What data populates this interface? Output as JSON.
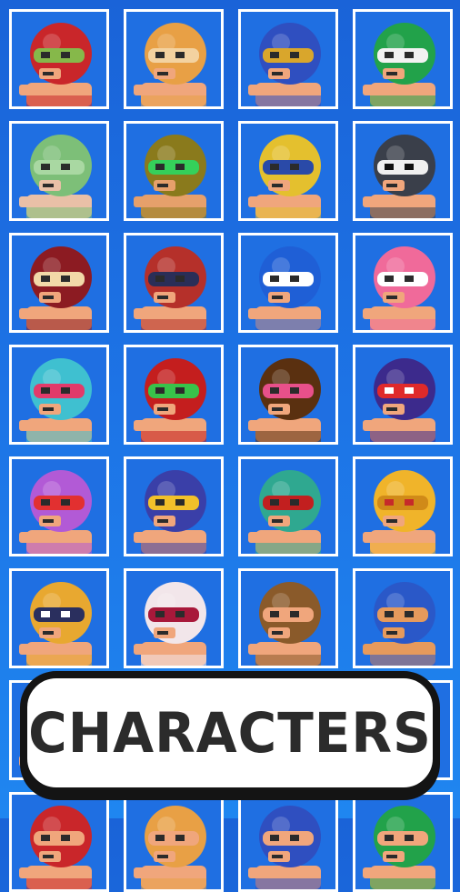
{
  "banner": {
    "label": "CHARACTERS"
  },
  "characters": [
    {
      "name": "red-mask-wrestler-icon",
      "helmet": "#c9262a",
      "mask": "#86b84a",
      "skin": "#f0a67c",
      "accent": "#2b2b2b"
    },
    {
      "name": "star-head-wrestler-icon",
      "helmet": "#e8a045",
      "mask": "#f3d2a0",
      "skin": "#f0a67c",
      "accent": "#2b2b2b"
    },
    {
      "name": "blue-gold-mask-wrestler-icon",
      "helmet": "#2f4fc0",
      "mask": "#d9a62c",
      "skin": "#f0a67c",
      "accent": "#2b2b2b"
    },
    {
      "name": "green-mask-wrestler-icon",
      "helmet": "#22a24a",
      "mask": "#f2f2f2",
      "skin": "#f0a67c",
      "accent": "#2b2b2b"
    },
    {
      "name": "light-green-mask-wrestler-icon",
      "helmet": "#7dbf78",
      "mask": "#a9d8a2",
      "skin": "#e9c0a7",
      "accent": "#2b2b2b"
    },
    {
      "name": "olive-mask-wrestler-icon",
      "helmet": "#8a7a1c",
      "mask": "#35d05a",
      "skin": "#e6a06b",
      "accent": "#2b2b2b"
    },
    {
      "name": "yellow-mask-wrestler-icon",
      "helmet": "#e4c02e",
      "mask": "#2a4aa8",
      "skin": "#f0a67c",
      "accent": "#2b2b2b"
    },
    {
      "name": "skull-mask-wrestler-icon",
      "helmet": "#3a3f4a",
      "mask": "#f0f0f0",
      "skin": "#f0a67c",
      "accent": "#111111"
    },
    {
      "name": "crimson-moon-mask-wrestler-icon",
      "helmet": "#8c1b22",
      "mask": "#f2d9a8",
      "skin": "#f0a67c",
      "accent": "#2b2b2b"
    },
    {
      "name": "dark-red-navy-mask-wrestler-icon",
      "helmet": "#b5302a",
      "mask": "#2a2e57",
      "skin": "#f0a67c",
      "accent": "#2b2b2b"
    },
    {
      "name": "blue-white-mask-wrestler-icon",
      "helmet": "#1f5fd6",
      "mask": "#ffffff",
      "skin": "#f0a67c",
      "accent": "#2b2b2b"
    },
    {
      "name": "pink-mask-wrestler-icon",
      "helmet": "#f06a9a",
      "mask": "#ffffff",
      "skin": "#f0a67c",
      "accent": "#2b2b2b"
    },
    {
      "name": "teal-mask-wrestler-icon",
      "helmet": "#3fc0d0",
      "mask": "#e23a6a",
      "skin": "#f0a67c",
      "accent": "#2b2b2b"
    },
    {
      "name": "red-green-mask-wrestler-icon",
      "helmet": "#c41e1e",
      "mask": "#38c24a",
      "skin": "#f0a67c",
      "accent": "#2b2b2b"
    },
    {
      "name": "brown-mask-wrestler-icon",
      "helmet": "#5a3010",
      "mask": "#e8508a",
      "skin": "#f0a67c",
      "accent": "#2b2b2b"
    },
    {
      "name": "stripe-mask-wrestler-icon",
      "helmet": "#3c2a8c",
      "mask": "#e02a2a",
      "skin": "#f0a67c",
      "accent": "#ffffff"
    },
    {
      "name": "purple-mask-wrestler-icon",
      "helmet": "#b25ad6",
      "mask": "#e23030",
      "skin": "#f0a67c",
      "accent": "#2b2b2b"
    },
    {
      "name": "horned-blue-mask-wrestler-icon",
      "helmet": "#3a3fa8",
      "mask": "#f2c12a",
      "skin": "#f0a67c",
      "accent": "#2b2b2b"
    },
    {
      "name": "horned-teal-mask-wrestler-icon",
      "helmet": "#2fa890",
      "mask": "#c21f1f",
      "skin": "#f0a67c",
      "accent": "#2b2b2b"
    },
    {
      "name": "knight-helmet-icon",
      "helmet": "#f0b42a",
      "mask": "#d08a18",
      "skin": "#f0a67c",
      "accent": "#c62a2a"
    },
    {
      "name": "gold-navy-mask-wrestler-icon",
      "helmet": "#e8a830",
      "mask": "#2a2f5e",
      "skin": "#f0a67c",
      "accent": "#ffffff"
    },
    {
      "name": "white-red-mask-wrestler-icon",
      "helmet": "#f2e6ea",
      "mask": "#a8183a",
      "skin": "#f0a67c",
      "accent": "#2b2b2b"
    },
    {
      "name": "brown-hair-wrestler-icon",
      "helmet": "#8a5a2a",
      "mask": "#f0a67c",
      "skin": "#f0a67c",
      "accent": "#2b2b2b"
    },
    {
      "name": "blue-pompadour-wrestler-icon",
      "helmet": "#2a58c8",
      "mask": "#e69a5c",
      "skin": "#e69a5c",
      "accent": "#2b2b2b"
    },
    {
      "name": "partial-card-icon",
      "helmet": "#c9262a",
      "mask": "#f0a67c",
      "skin": "#f0a67c",
      "accent": "#2b2b2b"
    },
    {
      "name": "partial-card-icon",
      "helmet": "#e8a045",
      "mask": "#f0a67c",
      "skin": "#f0a67c",
      "accent": "#2b2b2b"
    },
    {
      "name": "partial-card-icon",
      "helmet": "#2f4fc0",
      "mask": "#f0a67c",
      "skin": "#f0a67c",
      "accent": "#2b2b2b"
    },
    {
      "name": "partial-card-icon",
      "helmet": "#22a24a",
      "mask": "#f0a67c",
      "skin": "#f0a67c",
      "accent": "#2b2b2b"
    },
    {
      "name": "partial-card-icon",
      "helmet": "#c9262a",
      "mask": "#f0a67c",
      "skin": "#f0a67c",
      "accent": "#2b2b2b"
    },
    {
      "name": "partial-card-icon",
      "helmet": "#e8a045",
      "mask": "#f0a67c",
      "skin": "#f0a67c",
      "accent": "#2b2b2b"
    },
    {
      "name": "partial-card-icon",
      "helmet": "#2f4fc0",
      "mask": "#f0a67c",
      "skin": "#f0a67c",
      "accent": "#2b2b2b"
    },
    {
      "name": "partial-card-icon",
      "helmet": "#22a24a",
      "mask": "#f0a67c",
      "skin": "#f0a67c",
      "accent": "#2b2b2b"
    }
  ]
}
